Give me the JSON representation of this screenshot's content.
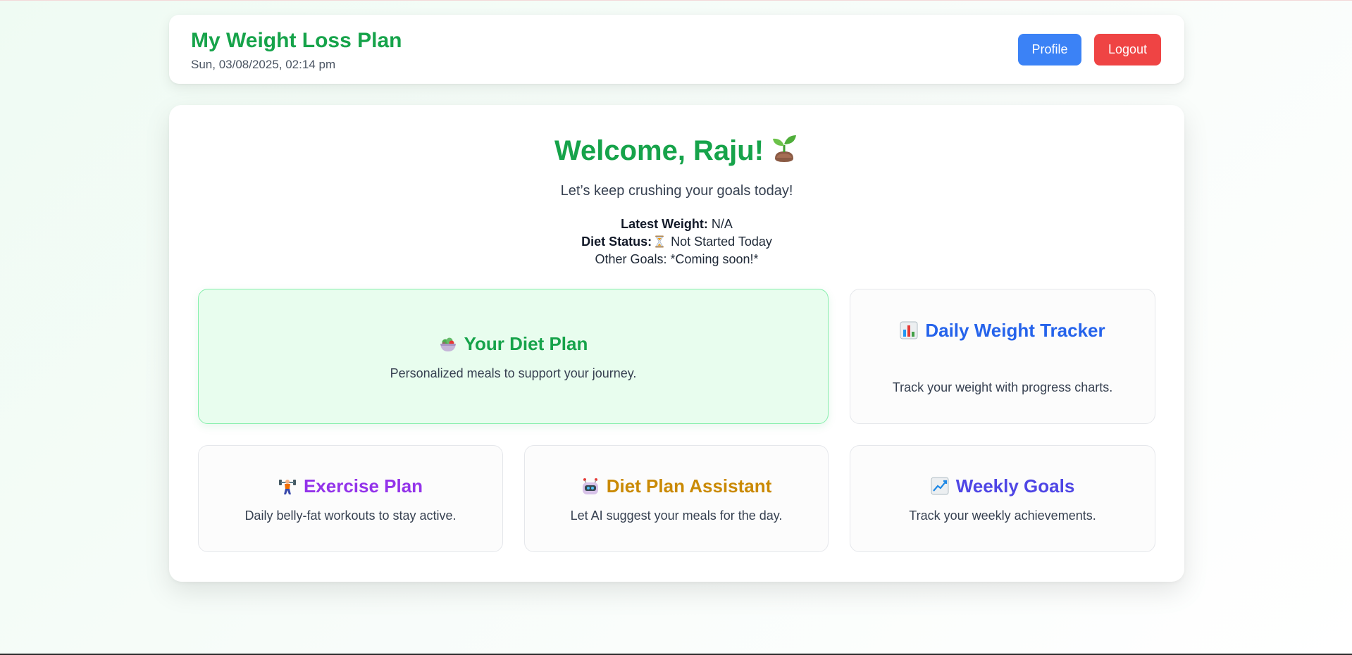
{
  "header": {
    "title": "My Weight Loss Plan",
    "datetime": "Sun, 03/08/2025, 02:14 pm",
    "profile_label": "Profile",
    "logout_label": "Logout"
  },
  "welcome": {
    "heading": "Welcome, Raju!",
    "heading_icon": "seedling-icon",
    "tagline": "Let’s keep crushing your goals today!"
  },
  "stats": {
    "weight_label": "Latest Weight:",
    "weight_value": "N/A",
    "diet_status_label": "Diet Status:",
    "diet_status_icon": "hourglass-icon",
    "diet_status_value": "Not Started Today",
    "other_goals": "Other Goals: *Coming soon!*"
  },
  "cards": {
    "diet_plan": {
      "icon": "salad-bowl-icon",
      "title": "Your Diet Plan",
      "desc": "Personalized meals to support your journey.",
      "color": "#16a34a"
    },
    "weight_tracker": {
      "icon": "bar-chart-icon",
      "title": "Daily Weight Tracker",
      "desc": "Track your weight with progress charts.",
      "color": "#2563eb"
    },
    "exercise_plan": {
      "icon": "weightlifter-icon",
      "title": "Exercise Plan",
      "desc": "Daily belly-fat workouts to stay active.",
      "color": "#9333ea"
    },
    "diet_assistant": {
      "icon": "robot-icon",
      "title": "Diet Plan Assistant",
      "desc": "Let AI suggest your meals for the day.",
      "color": "#ca8a04"
    },
    "weekly_goals": {
      "icon": "trending-up-chart-icon",
      "title": "Weekly Goals",
      "desc": "Track your weekly achievements.",
      "color": "#4f46e5"
    }
  },
  "colors": {
    "brand_green": "#16a34a",
    "profile_button": "#3b82f6",
    "logout_button": "#ef4444"
  }
}
